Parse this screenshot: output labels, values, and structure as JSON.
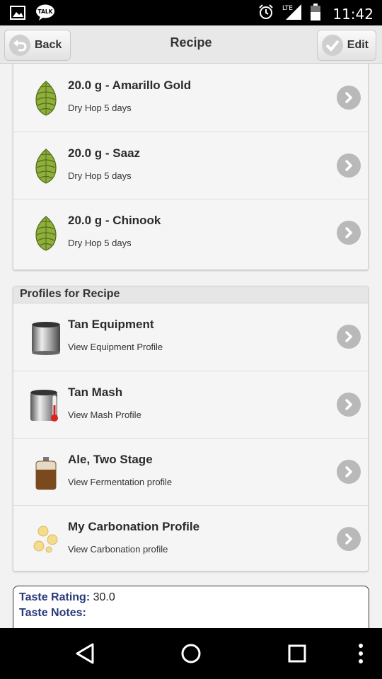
{
  "status_bar": {
    "time": "11:42",
    "talk_badge": "TALK",
    "network": "LTE",
    "icons": [
      "image-notification-icon",
      "talk-notification-icon",
      "alarm-icon",
      "lte-signal-icon",
      "battery-icon"
    ]
  },
  "action_bar": {
    "back_label": "Back",
    "title": "Recipe",
    "edit_label": "Edit"
  },
  "hops": [
    {
      "title": "20.0 g - Amarillo Gold",
      "subtitle": "Dry Hop 5 days",
      "icon": "hop-icon"
    },
    {
      "title": "20.0 g - Saaz",
      "subtitle": "Dry Hop 5 days",
      "icon": "hop-icon"
    },
    {
      "title": "20.0 g - Chinook",
      "subtitle": "Dry Hop 5 days",
      "icon": "hop-icon"
    }
  ],
  "profiles_section": {
    "header": "Profiles for Recipe",
    "items": [
      {
        "title": "Tan Equipment",
        "subtitle": "View Equipment Profile",
        "icon": "kettle-icon"
      },
      {
        "title": "Tan Mash",
        "subtitle": "View Mash Profile",
        "icon": "mash-kettle-thermometer-icon"
      },
      {
        "title": "Ale, Two Stage",
        "subtitle": "View Fermentation profile",
        "icon": "fermenter-icon"
      },
      {
        "title": "My Carbonation Profile",
        "subtitle": "View Carbonation profile",
        "icon": "carbonation-bubbles-icon"
      }
    ]
  },
  "taste": {
    "rating_label": "Taste Rating:",
    "rating_value": "30.0",
    "notes_label": "Taste Notes:"
  },
  "nav_bar": {
    "buttons": [
      "back-nav-icon",
      "home-nav-icon",
      "recents-nav-icon",
      "overflow-menu-icon"
    ]
  },
  "colors": {
    "taste_label": "#2b3a7a",
    "chevron": "#b9b9b9",
    "hop_green": "#8fae3a"
  }
}
